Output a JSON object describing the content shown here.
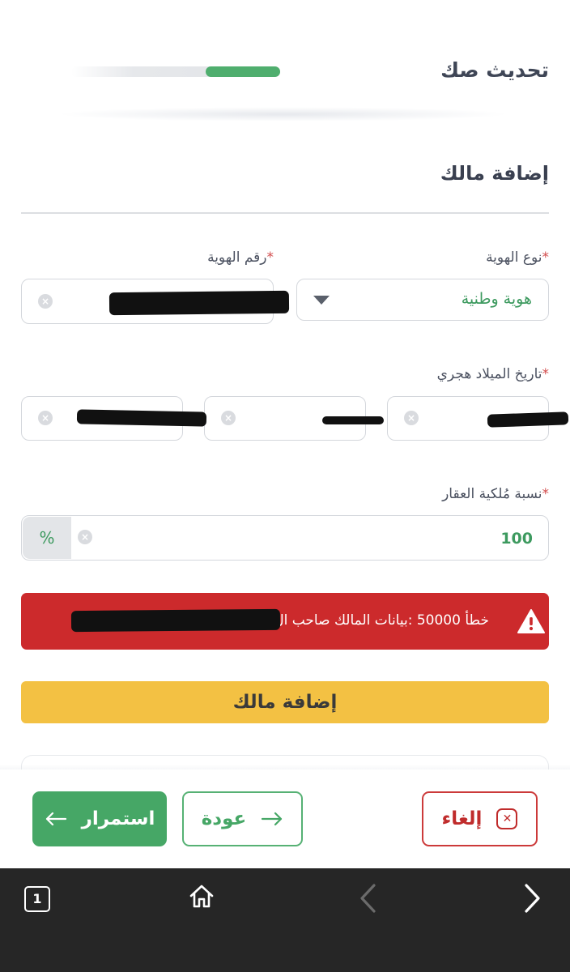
{
  "header": {
    "title": "تحديث صك",
    "progress_fraction": 0.36
  },
  "section": {
    "title": "إضافة مالك"
  },
  "form": {
    "id_type_label": "نوع الهوية",
    "id_type_value": "هوية وطنية",
    "id_number_label": "رقم الهوية",
    "birth_date_label": "تاريخ الميلاد هجري",
    "ownership_label": "نسبة مُلكية العقار",
    "ownership_value": "100",
    "percent_symbol": "%",
    "required_marker": "*"
  },
  "error": {
    "message": "خطأ 50000 :بيانات المالك صاحب ال"
  },
  "actions": {
    "add_owner_label": "إضافة مالك",
    "continue_label": "استمرار",
    "back_label": "عودة",
    "cancel_label": "إلغاء"
  },
  "browser": {
    "tab_count": "1"
  },
  "colors": {
    "primary_green": "#46a766",
    "error_red": "#cc2a2c",
    "warning_yellow": "#f3c143"
  },
  "icons": {
    "clear": "clear-icon",
    "dropdown": "chevron-down-icon",
    "warning": "warning-icon",
    "back_arrow": "arrow-right-icon",
    "continue_arrow": "arrow-left-icon",
    "cancel": "close-box-icon",
    "home": "home-icon",
    "browser_back": "chevron-left-icon",
    "browser_forward": "chevron-right-icon"
  }
}
